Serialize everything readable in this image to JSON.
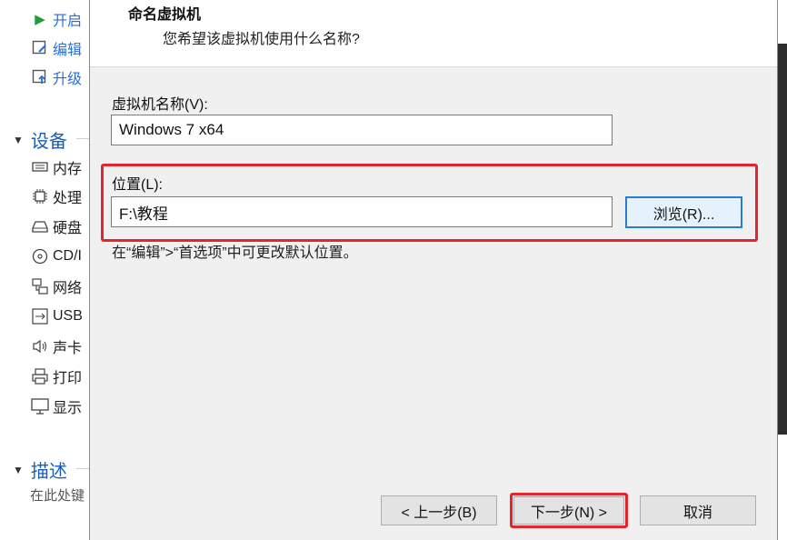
{
  "sidebar": {
    "actions": [
      {
        "label": "开启",
        "icon": "play-icon"
      },
      {
        "label": "编辑",
        "icon": "edit-icon"
      },
      {
        "label": "升级",
        "icon": "upgrade-icon"
      }
    ],
    "devices_header": "设备",
    "devices": [
      {
        "label": "内存",
        "icon": "memory-icon"
      },
      {
        "label": "处理",
        "icon": "processor-icon"
      },
      {
        "label": "硬盘",
        "icon": "harddisk-icon"
      },
      {
        "label": "CD/I",
        "icon": "cd-icon"
      },
      {
        "label": "网络",
        "icon": "network-icon"
      },
      {
        "label": "USB",
        "icon": "usb-icon"
      },
      {
        "label": "声卡",
        "icon": "sound-icon"
      },
      {
        "label": "打印",
        "icon": "printer-icon"
      },
      {
        "label": "显示",
        "icon": "display-icon"
      }
    ],
    "description_header": "描述",
    "description_placeholder": "在此处键"
  },
  "dialog": {
    "title": "命名虚拟机",
    "subtitle": "您希望该虚拟机使用什么名称?",
    "vm_name_label": "虚拟机名称(V):",
    "vm_name_value": "Windows 7 x64",
    "location_label": "位置(L):",
    "location_value": "F:\\教程",
    "browse_label": "浏览(R)...",
    "hint": "在“编辑”>“首选项”中可更改默认位置。",
    "back_label": "< 上一步(B)",
    "next_label": "下一步(N) >",
    "cancel_label": "取消"
  },
  "colors": {
    "highlight": "#e3262b",
    "accent": "#2a7bd4",
    "section_header": "#1a5fb4"
  }
}
